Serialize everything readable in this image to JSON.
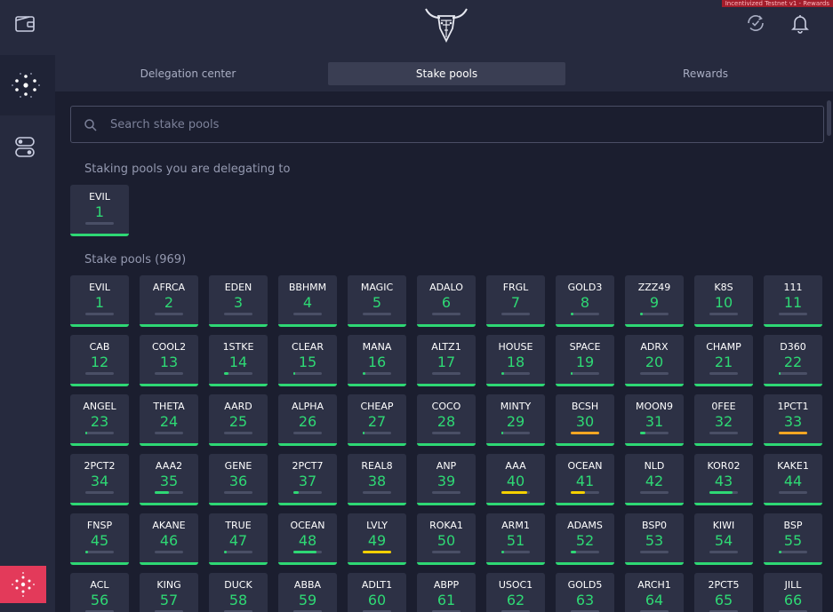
{
  "app": {
    "banner": "Incentivized Testnet v1 - Rewards"
  },
  "tabs": [
    {
      "label": "Delegation center",
      "active": false
    },
    {
      "label": "Stake pools",
      "active": true
    },
    {
      "label": "Rewards",
      "active": false
    }
  ],
  "search": {
    "placeholder": "Search stake pools",
    "value": ""
  },
  "delegating": {
    "label": "Staking pools you are delegating to",
    "pools": [
      {
        "ticker": "EVIL",
        "rank": "1",
        "saturation": 0,
        "saturation_color": "#4a4f66"
      }
    ]
  },
  "stake_pools": {
    "label": "Stake pools (969)",
    "pools": [
      {
        "ticker": "EVIL",
        "rank": "1",
        "saturation": 0,
        "saturation_color": "#4a4f66"
      },
      {
        "ticker": "AFRCA",
        "rank": "2",
        "saturation": 0,
        "saturation_color": "#4a4f66"
      },
      {
        "ticker": "EDEN",
        "rank": "3",
        "saturation": 0,
        "saturation_color": "#4a4f66"
      },
      {
        "ticker": "BBHMM",
        "rank": "4",
        "saturation": 0,
        "saturation_color": "#4a4f66"
      },
      {
        "ticker": "MAGIC",
        "rank": "5",
        "saturation": 0,
        "saturation_color": "#4a4f66"
      },
      {
        "ticker": "ADALO",
        "rank": "6",
        "saturation": 0,
        "saturation_color": "#4a4f66"
      },
      {
        "ticker": "FRGL",
        "rank": "7",
        "saturation": 0,
        "saturation_color": "#4a4f66"
      },
      {
        "ticker": "GOLD3",
        "rank": "8",
        "saturation": 0.1,
        "saturation_color": "#2ed874"
      },
      {
        "ticker": "ZZZ49",
        "rank": "9",
        "saturation": 0.1,
        "saturation_color": "#2ed874"
      },
      {
        "ticker": "K8S",
        "rank": "10",
        "saturation": 0,
        "saturation_color": "#4a4f66"
      },
      {
        "ticker": "111",
        "rank": "11",
        "saturation": 0,
        "saturation_color": "#4a4f66"
      },
      {
        "ticker": "CAB",
        "rank": "12",
        "saturation": 0,
        "saturation_color": "#4a4f66"
      },
      {
        "ticker": "COOL2",
        "rank": "13",
        "saturation": 0,
        "saturation_color": "#4a4f66"
      },
      {
        "ticker": "1STKE",
        "rank": "14",
        "saturation": 0.15,
        "saturation_color": "#2ed874"
      },
      {
        "ticker": "CLEAR",
        "rank": "15",
        "saturation": 0.05,
        "saturation_color": "#2ed874"
      },
      {
        "ticker": "MANA",
        "rank": "16",
        "saturation": 0.1,
        "saturation_color": "#2ed874"
      },
      {
        "ticker": "ALTZ1",
        "rank": "17",
        "saturation": 0,
        "saturation_color": "#4a4f66"
      },
      {
        "ticker": "HOUSE",
        "rank": "18",
        "saturation": 0.1,
        "saturation_color": "#2ed874"
      },
      {
        "ticker": "SPACE",
        "rank": "19",
        "saturation": 0.05,
        "saturation_color": "#2ed874"
      },
      {
        "ticker": "ADRX",
        "rank": "20",
        "saturation": 0,
        "saturation_color": "#4a4f66"
      },
      {
        "ticker": "CHAMP",
        "rank": "21",
        "saturation": 0,
        "saturation_color": "#4a4f66"
      },
      {
        "ticker": "D360",
        "rank": "22",
        "saturation": 0.05,
        "saturation_color": "#2ed874"
      },
      {
        "ticker": "ANGEL",
        "rank": "23",
        "saturation": 0.05,
        "saturation_color": "#2ed874"
      },
      {
        "ticker": "THETA",
        "rank": "24",
        "saturation": 0,
        "saturation_color": "#4a4f66"
      },
      {
        "ticker": "AARD",
        "rank": "25",
        "saturation": 0,
        "saturation_color": "#4a4f66"
      },
      {
        "ticker": "ALPHA",
        "rank": "26",
        "saturation": 0,
        "saturation_color": "#4a4f66"
      },
      {
        "ticker": "CHEAP",
        "rank": "27",
        "saturation": 0.05,
        "saturation_color": "#2ed874"
      },
      {
        "ticker": "COCO",
        "rank": "28",
        "saturation": 0,
        "saturation_color": "#4a4f66"
      },
      {
        "ticker": "MINTY",
        "rank": "29",
        "saturation": 0.05,
        "saturation_color": "#2ed874"
      },
      {
        "ticker": "BCSH",
        "rank": "30",
        "saturation": 1,
        "saturation_color": "#f5a623"
      },
      {
        "ticker": "MOON9",
        "rank": "31",
        "saturation": 0.2,
        "saturation_color": "#2ed874"
      },
      {
        "ticker": "0FEE",
        "rank": "32",
        "saturation": 0,
        "saturation_color": "#4a4f66"
      },
      {
        "ticker": "1PCT1",
        "rank": "33",
        "saturation": 1,
        "saturation_color": "#f5a623"
      },
      {
        "ticker": "2PCT2",
        "rank": "34",
        "saturation": 0,
        "saturation_color": "#4a4f66"
      },
      {
        "ticker": "AAA2",
        "rank": "35",
        "saturation": 0.5,
        "saturation_color": "#2ed874"
      },
      {
        "ticker": "GENE",
        "rank": "36",
        "saturation": 0,
        "saturation_color": "#4a4f66"
      },
      {
        "ticker": "2PCT7",
        "rank": "37",
        "saturation": 0.2,
        "saturation_color": "#2ed874"
      },
      {
        "ticker": "REAL8",
        "rank": "38",
        "saturation": 0,
        "saturation_color": "#4a4f66"
      },
      {
        "ticker": "ANP",
        "rank": "39",
        "saturation": 0,
        "saturation_color": "#4a4f66"
      },
      {
        "ticker": "AAA",
        "rank": "40",
        "saturation": 0.9,
        "saturation_color": "#f5d000"
      },
      {
        "ticker": "OCEAN",
        "rank": "41",
        "saturation": 0.5,
        "saturation_color": "#f5d000"
      },
      {
        "ticker": "NLD",
        "rank": "42",
        "saturation": 0,
        "saturation_color": "#4a4f66"
      },
      {
        "ticker": "KOR02",
        "rank": "43",
        "saturation": 0.8,
        "saturation_color": "#2ed874"
      },
      {
        "ticker": "KAKE1",
        "rank": "44",
        "saturation": 0,
        "saturation_color": "#4a4f66"
      },
      {
        "ticker": "FNSP",
        "rank": "45",
        "saturation": 0.1,
        "saturation_color": "#2ed874"
      },
      {
        "ticker": "AKANE",
        "rank": "46",
        "saturation": 0,
        "saturation_color": "#4a4f66"
      },
      {
        "ticker": "TRUE",
        "rank": "47",
        "saturation": 0.1,
        "saturation_color": "#2ed874"
      },
      {
        "ticker": "OCEAN",
        "rank": "48",
        "saturation": 0.8,
        "saturation_color": "#2ed874"
      },
      {
        "ticker": "LVLY",
        "rank": "49",
        "saturation": 1,
        "saturation_color": "#f5d000"
      },
      {
        "ticker": "ROKA1",
        "rank": "50",
        "saturation": 0,
        "saturation_color": "#4a4f66"
      },
      {
        "ticker": "ARM1",
        "rank": "51",
        "saturation": 0.1,
        "saturation_color": "#2ed874"
      },
      {
        "ticker": "ADAMS",
        "rank": "52",
        "saturation": 0.2,
        "saturation_color": "#2ed874"
      },
      {
        "ticker": "BSP0",
        "rank": "53",
        "saturation": 0,
        "saturation_color": "#4a4f66"
      },
      {
        "ticker": "KIWI",
        "rank": "54",
        "saturation": 0,
        "saturation_color": "#4a4f66"
      },
      {
        "ticker": "BSP",
        "rank": "55",
        "saturation": 0.1,
        "saturation_color": "#2ed874"
      },
      {
        "ticker": "ACL",
        "rank": "56",
        "saturation": 0,
        "saturation_color": "#4a4f66"
      },
      {
        "ticker": "KING",
        "rank": "57",
        "saturation": 0,
        "saturation_color": "#4a4f66"
      },
      {
        "ticker": "DUCK",
        "rank": "58",
        "saturation": 0,
        "saturation_color": "#4a4f66"
      },
      {
        "ticker": "ABBA",
        "rank": "59",
        "saturation": 0,
        "saturation_color": "#4a4f66"
      },
      {
        "ticker": "ADLT1",
        "rank": "60",
        "saturation": 0,
        "saturation_color": "#4a4f66"
      },
      {
        "ticker": "ABPP",
        "rank": "61",
        "saturation": 0,
        "saturation_color": "#4a4f66"
      },
      {
        "ticker": "USOC1",
        "rank": "62",
        "saturation": 0,
        "saturation_color": "#4a4f66"
      },
      {
        "ticker": "GOLD5",
        "rank": "63",
        "saturation": 0,
        "saturation_color": "#4a4f66"
      },
      {
        "ticker": "ARCH1",
        "rank": "64",
        "saturation": 0,
        "saturation_color": "#4a4f66"
      },
      {
        "ticker": "2PCT5",
        "rank": "65",
        "saturation": 0,
        "saturation_color": "#4a4f66"
      },
      {
        "ticker": "JILL",
        "rank": "66",
        "saturation": 0,
        "saturation_color": "#4a4f66"
      }
    ]
  },
  "colors": {
    "rank_green": "#2ed874",
    "sidebar_bg": "#262a3e",
    "content_bg": "#1b1e2f",
    "tile_bg": "#2d3145",
    "cardano_pink": "#e33a5a"
  },
  "icons": {
    "wallet": "wallet-icon",
    "staking": "staking-dots-icon",
    "settings": "settings-toggle-icon",
    "cardano": "cardano-logo-icon",
    "logo": "daedalus-bull-logo",
    "sync": "sync-check-icon",
    "notifications": "bell-icon",
    "search": "search-icon"
  }
}
